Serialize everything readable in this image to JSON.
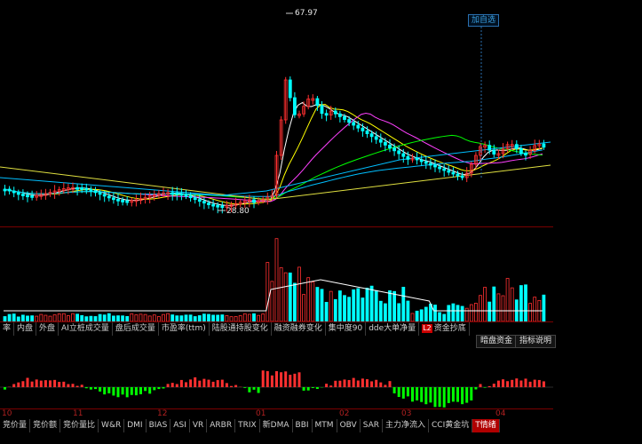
{
  "price_panel": {
    "high_label": "67.97",
    "low_label": "28.80",
    "add_self_button": "加自选"
  },
  "vol_tabs": [
    {
      "label": "率"
    },
    {
      "label": "内盘"
    },
    {
      "label": "外盘"
    },
    {
      "label": "AI立桩成交量"
    },
    {
      "label": "盘后成交量"
    },
    {
      "label": "市盈率(ttm)"
    },
    {
      "label": "陆股通持股变化"
    },
    {
      "label": "融资融券变化"
    },
    {
      "label": "集中度90"
    },
    {
      "label": "dde大单净量"
    },
    {
      "label": "资金抄底",
      "mark": "L2"
    }
  ],
  "side_buttons": {
    "dark_pool": "暗盘资金",
    "indicator_help": "指标说明"
  },
  "date_labels": [
    "10",
    "11",
    "12",
    "01",
    "02",
    "03",
    "04"
  ],
  "ind_tabs": [
    {
      "label": "竞价量"
    },
    {
      "label": "竞价额"
    },
    {
      "label": "竞价量比"
    },
    {
      "label": "W&R"
    },
    {
      "label": "DMI"
    },
    {
      "label": "BIAS"
    },
    {
      "label": "ASI"
    },
    {
      "label": "VR"
    },
    {
      "label": "ARBR"
    },
    {
      "label": "TRIX"
    },
    {
      "label": "新DMA"
    },
    {
      "label": "BBI"
    },
    {
      "label": "MTM"
    },
    {
      "label": "OBV"
    },
    {
      "label": "SAR"
    },
    {
      "label": "主力净流入"
    },
    {
      "label": "CCI黄金坑"
    },
    {
      "label": "T情绪",
      "active": true
    }
  ],
  "colors": {
    "up": "#ff3030",
    "down": "#00ffff",
    "grid": "#7a0000",
    "ma5": "#ffffff",
    "ma10": "#ffff00",
    "ma20": "#ff40ff",
    "ma60": "#00ff00",
    "ma120": "#00bfff",
    "ma250": "#e0e040",
    "pos_bar": "#ff3030",
    "neg_bar": "#00ff00"
  }
}
